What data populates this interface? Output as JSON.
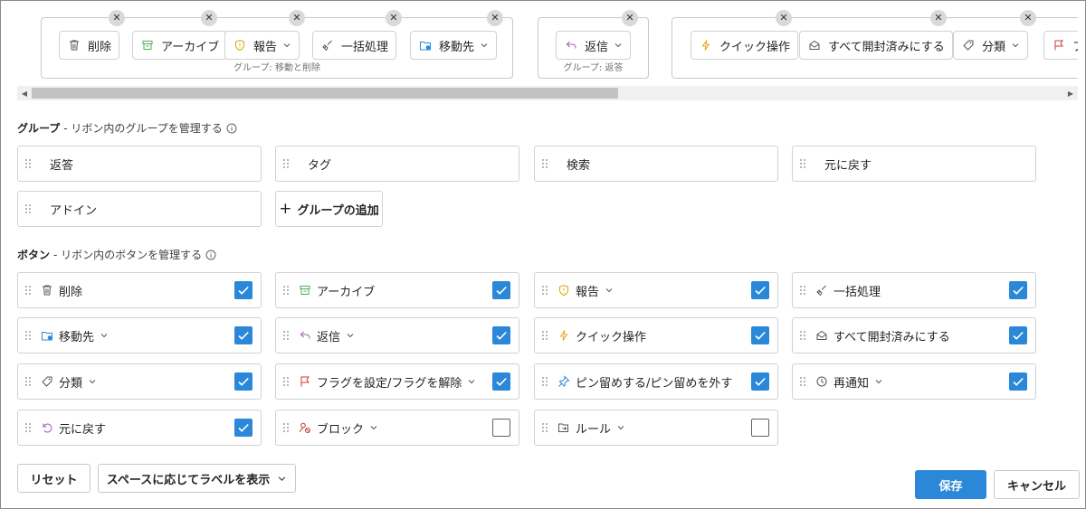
{
  "ribbon": {
    "group1": {
      "label": "グループ: 移動と削除",
      "buttons": [
        "削除",
        "アーカイブ",
        "報告",
        "一括処理",
        "移動先"
      ]
    },
    "group2": {
      "label": "グループ: 返答",
      "buttons": [
        "返信"
      ]
    },
    "group3": {
      "buttons": [
        "クイック操作",
        "すべて開封済みにする",
        "分類",
        "フ"
      ]
    },
    "close_glyph": "✕",
    "scroll_left": "◀",
    "scroll_right": "▶"
  },
  "groups_section": {
    "title": "グループ",
    "subtitle": "- リボン内のグループを管理する",
    "items": [
      "返答",
      "タグ",
      "検索",
      "元に戻す",
      "アドイン"
    ],
    "add_label": "グループの追加",
    "add_glyph": "+"
  },
  "buttons_section": {
    "title": "ボタン",
    "subtitle": "- リボン内のボタンを管理する",
    "items": [
      {
        "label": "削除",
        "icon": "trash-icon",
        "checked": true,
        "dropdown": false
      },
      {
        "label": "アーカイブ",
        "icon": "archive-icon",
        "checked": true,
        "dropdown": false
      },
      {
        "label": "報告",
        "icon": "shield-icon",
        "checked": true,
        "dropdown": true
      },
      {
        "label": "一括処理",
        "icon": "broom-icon",
        "checked": true,
        "dropdown": false
      },
      {
        "label": "移動先",
        "icon": "folder-move-icon",
        "checked": true,
        "dropdown": true
      },
      {
        "label": "返信",
        "icon": "reply-icon",
        "checked": true,
        "dropdown": true
      },
      {
        "label": "クイック操作",
        "icon": "lightning-icon",
        "checked": true,
        "dropdown": false
      },
      {
        "label": "すべて開封済みにする",
        "icon": "mail-open-icon",
        "checked": true,
        "dropdown": false
      },
      {
        "label": "分類",
        "icon": "tag-icon",
        "checked": true,
        "dropdown": true
      },
      {
        "label": "フラグを設定/フラグを解除",
        "icon": "flag-icon",
        "checked": true,
        "dropdown": true
      },
      {
        "label": "ピン留めする/ピン留めを外す",
        "icon": "pin-icon",
        "checked": true,
        "dropdown": false
      },
      {
        "label": "再通知",
        "icon": "clock-icon",
        "checked": true,
        "dropdown": true
      },
      {
        "label": "元に戻す",
        "icon": "undo-icon",
        "checked": true,
        "dropdown": false
      },
      {
        "label": "ブロック",
        "icon": "block-icon",
        "checked": false,
        "dropdown": true
      },
      {
        "label": "ルール",
        "icon": "rules-icon",
        "checked": false,
        "dropdown": true
      }
    ]
  },
  "footer": {
    "reset": "リセット",
    "label_mode": "スペースに応じてラベルを表示",
    "save": "保存",
    "cancel": "キャンセル"
  },
  "colors": {
    "accent": "#2b88d8",
    "archive": "#4caf50",
    "shield": "#d8a200",
    "reply": "#a05fb0",
    "flag": "#d13438",
    "lightning": "#e8a317",
    "block": "#c0392b"
  }
}
